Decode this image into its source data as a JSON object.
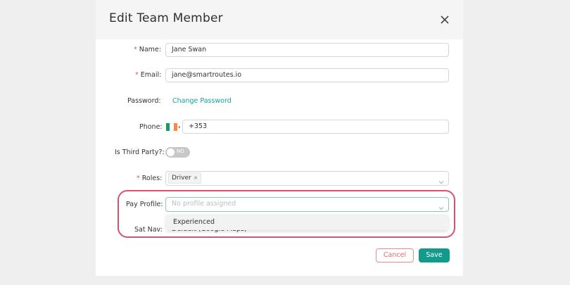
{
  "modal": {
    "title": "Edit Team Member",
    "close_icon": "close-icon"
  },
  "form": {
    "required_mark": "*",
    "name": {
      "label": "Name",
      "value": "Jane Swan"
    },
    "email": {
      "label": "Email",
      "value": "jane@smartroutes.io"
    },
    "password": {
      "label": "Password",
      "link": "Change Password"
    },
    "phone": {
      "label": "Phone",
      "value": "+353",
      "country_flag": "ireland-flag-icon"
    },
    "third_party": {
      "label": "Is Third Party?",
      "toggle_text": "NO"
    },
    "roles": {
      "label": "Roles",
      "tags": [
        "Driver"
      ],
      "remove_glyph": "×"
    },
    "pay_profile": {
      "label": "Pay Profile",
      "placeholder": "No profile assigned",
      "options": [
        "Experienced"
      ]
    },
    "sat_nav": {
      "label": "Sat Nav",
      "value": "Default (Google Maps)"
    },
    "colon": ":"
  },
  "footer": {
    "cancel_label": "Cancel",
    "save_label": "Save"
  },
  "colors": {
    "accent": "#129b8c",
    "link": "#16a394",
    "required": "#e05a5a",
    "highlight": "#d6526f",
    "cancel": "#e26c6c"
  }
}
